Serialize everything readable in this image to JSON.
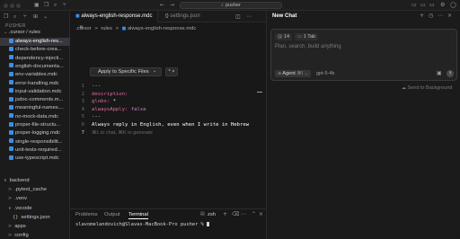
{
  "window": {
    "search_text": "pusher"
  },
  "tabs": [
    {
      "label": "always-english-response.mdc"
    },
    {
      "label": "settings.json",
      "icon_text": "{}"
    }
  ],
  "breadcrumb": {
    "parts": [
      ".cursor",
      ">",
      "rules",
      ">",
      "always-english-response.mdc"
    ]
  },
  "explorer": {
    "section": "PUSHER",
    "folder_label": ".cursor / rules",
    "files": [
      "always-english-res...",
      "check-before-crea...",
      "dependency-injecti...",
      "english-documenta...",
      "env-variables.mdc",
      "error-handling.mdc",
      "input-validation.mdc",
      "jsdoc-comments.m...",
      "meaningful-names....",
      "no-mock-data.mdc",
      "proper-file-structu...",
      "proper-logging.mdc",
      "single-responsibilit...",
      "unit-tests-required...",
      "use-typescript.mdc"
    ],
    "lower": [
      {
        "label": "backend",
        "indent": 0,
        "marker": "∨"
      },
      {
        "label": ".pytest_cache",
        "indent": 1,
        "marker": ">"
      },
      {
        "label": ".venv",
        "indent": 1,
        "marker": ">"
      },
      {
        "label": ".vscode",
        "indent": 1,
        "marker": "∨"
      },
      {
        "label": "settings.json",
        "indent": 2,
        "marker": "{}"
      },
      {
        "label": "apps",
        "indent": 1,
        "marker": ">"
      },
      {
        "label": "config",
        "indent": 1,
        "marker": ">"
      }
    ]
  },
  "editor": {
    "apply_label": "Apply to Specific Files",
    "lines": [
      {
        "n": "1",
        "parts": [
          {
            "t": "---",
            "c": "#d4d4d4"
          }
        ]
      },
      {
        "n": "2",
        "parts": [
          {
            "t": "description:",
            "c": "#e06c9f"
          }
        ]
      },
      {
        "n": "3",
        "parts": [
          {
            "t": "globs:",
            "c": "#e06c9f"
          },
          {
            "t": " *",
            "c": "#d4d4d4"
          }
        ]
      },
      {
        "n": "4",
        "parts": [
          {
            "t": "alwaysApply:",
            "c": "#e06c9f"
          },
          {
            "t": " false",
            "c": "#c586c0"
          }
        ]
      },
      {
        "n": "5",
        "parts": [
          {
            "t": "---",
            "c": "#d4d4d4"
          }
        ]
      },
      {
        "n": "6",
        "parts": [
          {
            "t": "Always reply in English, even when I write in Hebrew",
            "c": "#ffffff"
          }
        ]
      },
      {
        "n": "7",
        "parts": [
          {
            "t": "⌘L to chat, ⌘K to generate",
            "c": "#6a6a6a"
          }
        ]
      }
    ]
  },
  "panel": {
    "tabs": [
      "Problems",
      "Output",
      "Terminal"
    ],
    "active": "Terminal",
    "shell": "zsh",
    "prompt": "slavomelandovich@Slavas-MacBook-Pro pusher %"
  },
  "chat": {
    "title": "New Chat",
    "context_count": "14",
    "context_tab": "1 Tab",
    "placeholder": "Plan, search, build anything",
    "agent_label": "Agent",
    "agent_shortcut": "⌘I",
    "model": "gpt-5-4b",
    "send_background": "Send to Background"
  },
  "colors": {
    "accent": "#3b8eea",
    "bg": "#181818",
    "sidebar": "#1b1b1b"
  }
}
